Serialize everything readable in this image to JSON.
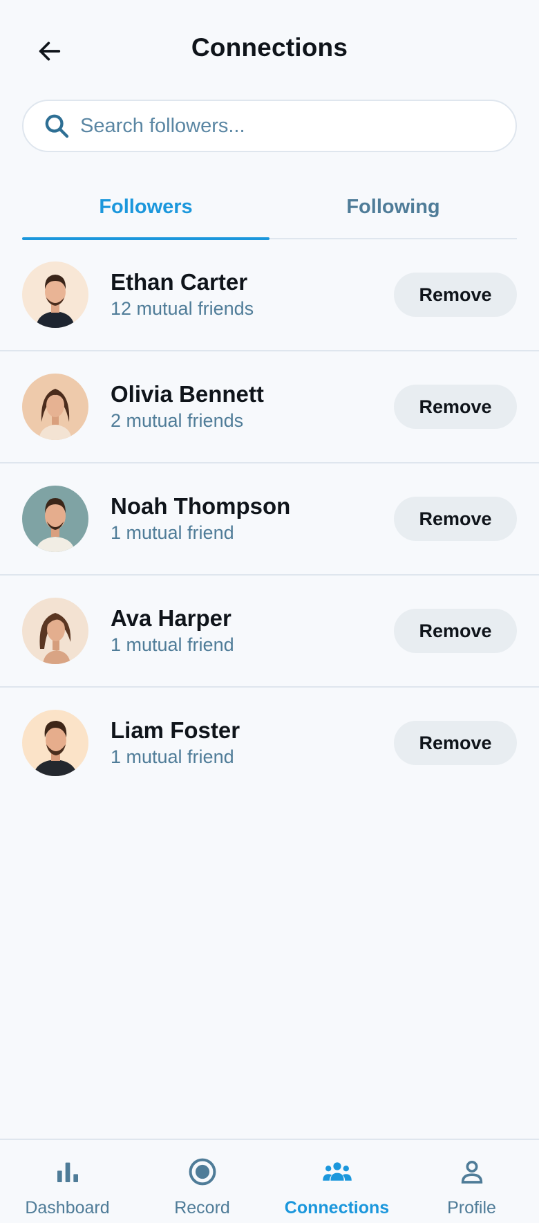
{
  "header": {
    "title": "Connections",
    "back_icon": "arrow-left-icon"
  },
  "search": {
    "placeholder": "Search followers...",
    "value": "",
    "icon": "search-icon"
  },
  "tabs": [
    {
      "label": "Followers",
      "active": true
    },
    {
      "label": "Following",
      "active": false
    }
  ],
  "followers": [
    {
      "name": "Ethan Carter",
      "mutual": "12 mutual friends",
      "action": "Remove"
    },
    {
      "name": "Olivia Bennett",
      "mutual": "2 mutual friends",
      "action": "Remove"
    },
    {
      "name": "Noah Thompson",
      "mutual": "1 mutual friend",
      "action": "Remove"
    },
    {
      "name": "Ava Harper",
      "mutual": "1 mutual friend",
      "action": "Remove"
    },
    {
      "name": "Liam Foster",
      "mutual": "1 mutual friend",
      "action": "Remove"
    }
  ],
  "bottom_nav": [
    {
      "label": "Dashboard",
      "icon": "bar-chart-icon",
      "active": false
    },
    {
      "label": "Record",
      "icon": "record-icon",
      "active": false
    },
    {
      "label": "Connections",
      "icon": "people-icon",
      "active": true
    },
    {
      "label": "Profile",
      "icon": "person-icon",
      "active": false
    }
  ],
  "colors": {
    "accent": "#1b97dc",
    "muted": "#4f7c98",
    "background": "#f7f9fc",
    "button_bg": "#e8edf1"
  }
}
